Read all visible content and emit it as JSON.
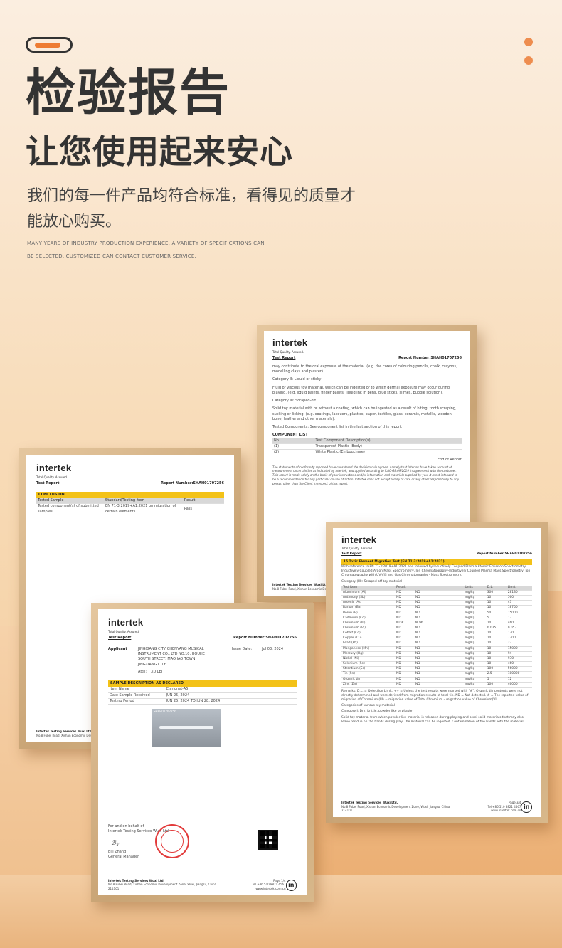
{
  "header": {
    "title": "检验报告",
    "subtitle": "让您使用起来安心",
    "description": "我们的每一件产品均符合标准，看得见的质量才能放心购买。",
    "english": "MANY YEARS OF INDUSTRY PRODUCTION EXPERIENCE, A VARIETY OF SPECIFICATIONS CAN BE SELECTED, CUSTOMIZED CAN CONTACT CUSTOMER SERVICE."
  },
  "colors": {
    "accent": "#ee7c33",
    "title": "#333333",
    "frame": "#d2ae80",
    "highlight": "#f3c218"
  },
  "brand": {
    "name": "intertek",
    "tagline": "Total Quality. Assured.",
    "lab": "Intertek Testing Services Wuxi Ltd.",
    "lab_address": "No.8 Fubei Road, Xishan Economic Development Zone, Wuxi, Jiangsu, China. 214101",
    "lab_contact": "Tel +86 510 8821 4567  www.intertek.com.cn"
  },
  "doc_left": {
    "test_report": "Test Report",
    "report_number": "Report Number:SHAH01707256",
    "conclusion": "CONCLUSION",
    "col_sample": "Tested Sample",
    "col_standard": "Standard/Testing Item",
    "col_result": "Result",
    "sample": "Tested component(s) of submitted samples",
    "standard": "EN 71-3:2019+A1:2021 on migration of certain elements",
    "result": "Pass"
  },
  "doc_back": {
    "test_report": "Test Report",
    "report_number": "Report Number:SHAH01707256",
    "p1": "may contribute to the oral exposure of the material. (e.g. the cores of colouring pencils, chalk, crayons, modelling clays and plaster).",
    "cat2": "Category II: Liquid or sticky",
    "p2": "Fluid or viscous toy material, which can be ingested or to which dermal exposure may occur during playing. (e.g. liquid paints, finger paints, liquid ink in pens, glue sticks, slimes, bubble solution).",
    "cat3": "Category III: Scraped-off",
    "p3": "Solid toy material with or without a coating, which can be ingested as a result of biting, tooth scraping, sucking or licking. (e.g. coatings, lacquers, plastics, paper, textiles, glass, ceramic, metallic, wooden, bone, leather and other materials).",
    "p4": "Tested Components: See component list in the last section of this report.",
    "component_list": "COMPONENT LIST",
    "col_no": "No.",
    "col_desc": "Test Component Description(s)",
    "components": [
      {
        "no": "(1)",
        "desc": "Transparent Plastic (Body)"
      },
      {
        "no": "(2)",
        "desc": "White Plastic (Embouchure)"
      }
    ],
    "end": "End of Report",
    "disclaimer": "The statements of conformity reported have considered the decision rule agreed, namely that Intertek have taken account of measurement uncertainties as indicated by Intertek, and applied according to ILAC-G8:09/2019 in agreement with the customer. This report is made solely on the basis of your instructions and/or information and materials supplied by you. It is not intended to be a recommendation for any particular course of action. Intertek does not accept a duty of care or any other responsibility to any person other than the Client in respect of this report."
  },
  "doc_front": {
    "test_report": "Test Report",
    "report_number": "Report Number:SHAH01707256",
    "applicant_label": "Applicant",
    "applicant": "JINGXIANG CITY CHENYANG MUSICAL INSTRUMENT CO., LTD NO.10, HOUHE SOUTH STREET, MAOJIAO TOWN, JINGXIANG CITY",
    "attn_label": "Attn:",
    "attn": "XU LEI",
    "issue_label": "Issue Date:",
    "issue_date": "Jul 03, 2024",
    "sample_header": "SAMPLE DESCRIPTION AS DECLARED",
    "rows": [
      {
        "k": "Item Name",
        "v": "Clarionet-A5"
      },
      {
        "k": "Date Sample Received",
        "v": "JUN 25, 2024"
      },
      {
        "k": "Testing Period",
        "v": "JUN 25, 2024 TO JUN 28, 2024"
      }
    ],
    "photo_label": "SHAH01707256",
    "signoff": "For and on behalf of",
    "signoff_lab": "Intertek Testing Services Wuxi Ltd.",
    "signer": "Bill Zhang",
    "signer_title": "General Manager",
    "page": "Page 1/4"
  },
  "doc_right": {
    "test_report": "Test Report",
    "report_number": "Report Number:SHAH01707256",
    "section": "15 Toxic Element Migration Test (EN 71-3:2019+A1:2021)",
    "intro": "With reference to EN 71-3:2019+A1:2021 and followed by Inductively Coupled Plasma Atomic Emission Spectrometry, Inductively Coupled Argon Mass Spectrometry, Ion Chromatography-Inductively Coupled Plasma Mass Spectrometry, Ion Chromatography with UV-VIS and Gas Chromatography - Mass Spectrometry.",
    "category": "Category (III): Scraped-off toy material",
    "col_item": "Test Item",
    "col_result": "Result",
    "col_units": "Units",
    "col_dl": "D.L.",
    "col_limit": "Limit",
    "elements": [
      [
        "Aluminium (Al)",
        "ND",
        "ND",
        "mg/kg",
        "300",
        "28130"
      ],
      [
        "Antimony (Sb)",
        "ND",
        "ND",
        "mg/kg",
        "10",
        "560"
      ],
      [
        "Arsenic (As)",
        "ND",
        "ND",
        "mg/kg",
        "10",
        "47"
      ],
      [
        "Barium (Ba)",
        "ND",
        "ND",
        "mg/kg",
        "10",
        "18750"
      ],
      [
        "Boron (B)",
        "ND",
        "ND",
        "mg/kg",
        "50",
        "15000"
      ],
      [
        "Cadmium (Cd)",
        "ND",
        "ND",
        "mg/kg",
        "5",
        "17"
      ],
      [
        "Chromium (III)",
        "ND#",
        "ND#",
        "mg/kg",
        "10",
        "460"
      ],
      [
        "Chromium (VI)",
        "ND",
        "ND",
        "mg/kg",
        "0.025",
        "0.053"
      ],
      [
        "Cobalt (Co)",
        "ND",
        "ND",
        "mg/kg",
        "10",
        "130"
      ],
      [
        "Copper (Cu)",
        "ND",
        "ND",
        "mg/kg",
        "10",
        "7700"
      ],
      [
        "Lead (Pb)",
        "ND",
        "ND",
        "mg/kg",
        "10",
        "23"
      ],
      [
        "Manganese (Mn)",
        "ND",
        "ND",
        "mg/kg",
        "10",
        "15000"
      ],
      [
        "Mercury (Hg)",
        "ND",
        "ND",
        "mg/kg",
        "10",
        "94"
      ],
      [
        "Nickel (Ni)",
        "ND",
        "ND",
        "mg/kg",
        "10",
        "930"
      ],
      [
        "Selenium (Se)",
        "ND",
        "ND",
        "mg/kg",
        "10",
        "460"
      ],
      [
        "Strontium (Sr)",
        "ND",
        "ND",
        "mg/kg",
        "100",
        "56000"
      ],
      [
        "Tin (Sn)",
        "ND",
        "ND",
        "mg/kg",
        "2.5",
        "180000"
      ],
      [
        "Organic tin",
        "ND",
        "ND",
        "mg/kg",
        "5",
        "12"
      ],
      [
        "Zinc (Zn)",
        "ND",
        "ND",
        "mg/kg",
        "100",
        "46000"
      ]
    ],
    "remarks": "Remarks: D.L. = Detection Limit. ++ = Unless the test results were marked with \"#\", Organic tin contents were not directly determined and were derived from migration results of total tin. ND = Not detected. # = The reported value of migration of Chromium (III) = migration value of Total Chromium – migration value of Chromium(VI).",
    "categories_title": "Categories of various toy material",
    "cat1": "Category I: Dry, brittle, powder like or pliable",
    "cat1_text": "Solid toy material from which powder-like material is released during playing and semi-solid materials that may also leave residue on the hands during play. The material can be ingested. Contamination of the hands with the material",
    "page": "Page 3/4"
  }
}
